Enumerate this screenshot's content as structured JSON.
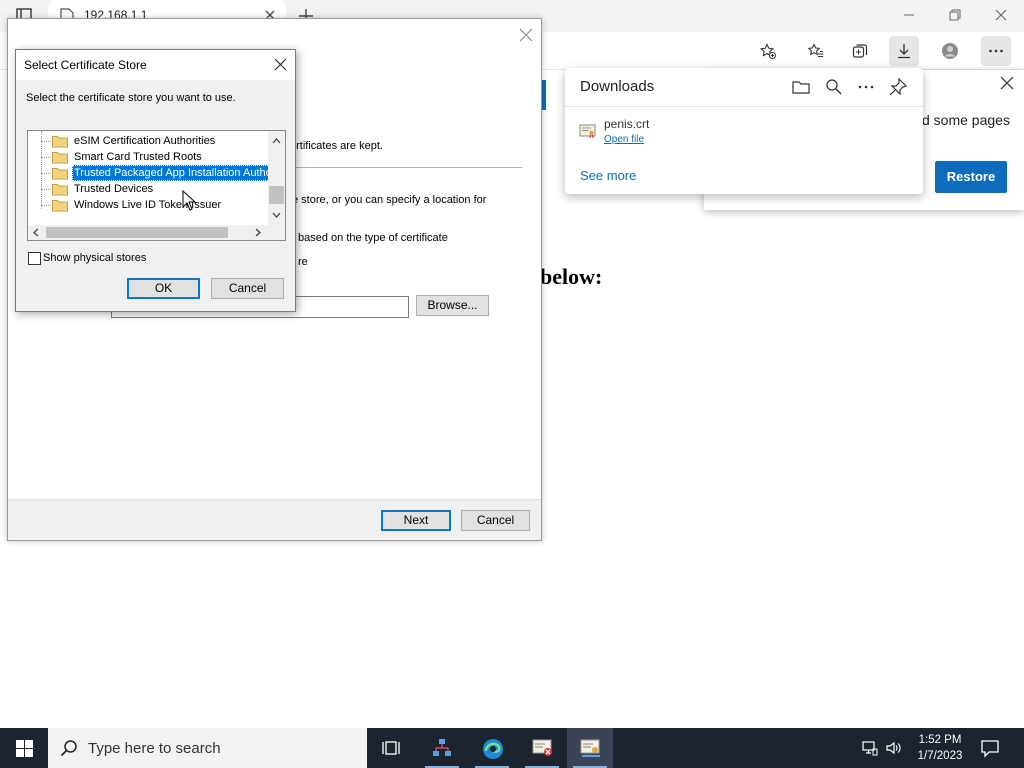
{
  "browser": {
    "tab_title": "192.168.1.1",
    "page_heading": "below:",
    "restore_text": "d some pages",
    "restore_button": "Restore"
  },
  "downloads": {
    "title": "Downloads",
    "file_name": "penis.crt",
    "open_file": "Open file",
    "see_more": "See more"
  },
  "wizard": {
    "text_kept": "ertificates are kept.",
    "text_store": "e store, or you can specify a location for",
    "text_auto": "based on the type of certificate",
    "text_re": "re",
    "browse_label": "Browse...",
    "next_label": "Next",
    "cancel_label": "Cancel"
  },
  "cert_store_dialog": {
    "title": "Select Certificate Store",
    "instruction": "Select the certificate store you want to use.",
    "tree_items": [
      "eSIM Certification Authorities",
      "Smart Card Trusted Roots",
      "Trusted Packaged App Installation Authorities",
      "Trusted Devices",
      "Windows Live ID Token Issuer"
    ],
    "selected_index": 2,
    "show_physical_label": "Show physical stores",
    "show_physical_checked": false,
    "ok_label": "OK",
    "cancel_label": "Cancel"
  },
  "taskbar": {
    "search_placeholder": "Type here to search",
    "time": "1:52 PM",
    "date": "1/7/2023"
  },
  "colors": {
    "accent": "#0078d7",
    "edge_blue": "#0f6cbd",
    "taskbar": "#1c2430"
  }
}
